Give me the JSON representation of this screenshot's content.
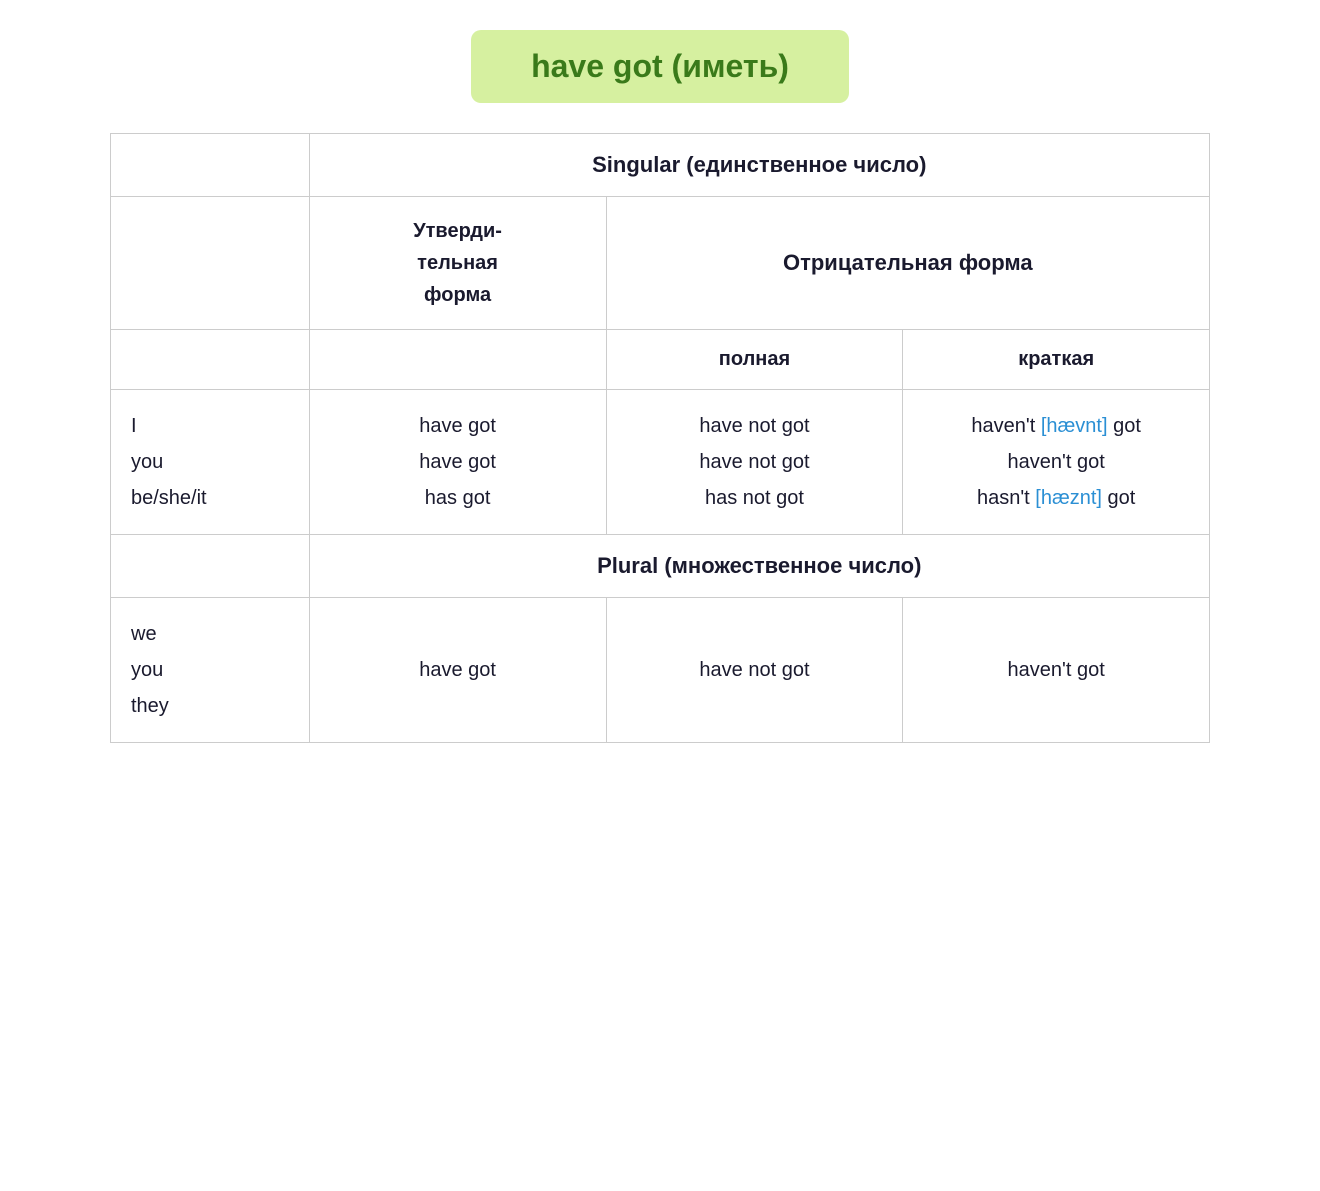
{
  "title": "have got (иметь)",
  "table": {
    "singular_header": "Singular (единственное число)",
    "plural_header": "Plural (множественное число)",
    "affirmative_label": "Утверди-\nтельная\nформа",
    "negative_label": "Отрицательная форма",
    "full_label": "полная",
    "short_label": "краткая",
    "singular_rows": {
      "pronouns": [
        "I",
        "you",
        "be/she/it"
      ],
      "affirmative": [
        "have got",
        "have got",
        "has got"
      ],
      "negative_full": [
        "have not got",
        "have not got",
        "has not got"
      ],
      "negative_short_prefix": [
        "haven't",
        "haven't",
        "hasn't"
      ],
      "negative_short_phonetic": [
        "[hævnt]",
        "",
        "[hæznt]"
      ],
      "negative_short_suffix": [
        "got",
        "got",
        "got"
      ]
    },
    "plural_rows": {
      "pronouns": [
        "we",
        "you",
        "they"
      ],
      "affirmative": "have got",
      "negative_full": "have not got",
      "negative_short": "haven't got"
    }
  }
}
